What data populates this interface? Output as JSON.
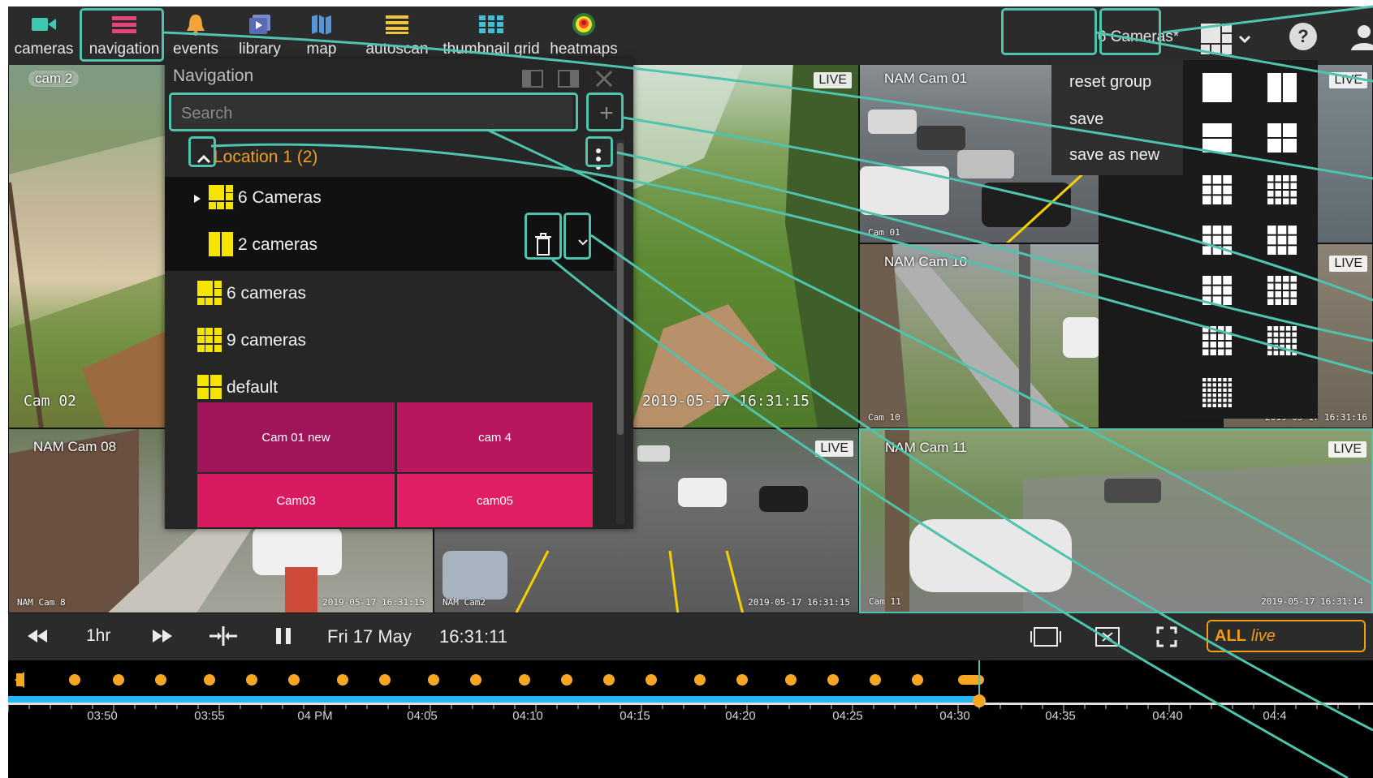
{
  "toolbar": {
    "items": [
      {
        "label": "cameras",
        "icon": "video-camera-icon"
      },
      {
        "label": "navigation",
        "icon": "navigation-list-icon"
      },
      {
        "label": "events",
        "icon": "bell-icon"
      },
      {
        "label": "library",
        "icon": "library-icon"
      },
      {
        "label": "map",
        "icon": "map-icon"
      },
      {
        "label": "autoscan",
        "icon": "autoscan-icon"
      },
      {
        "label": "thumbnail grid",
        "icon": "thumbnail-grid-icon"
      },
      {
        "label": "heatmaps",
        "icon": "heatmap-icon"
      }
    ],
    "group_name": "6 Cameras*",
    "help_label": "?"
  },
  "group_menu": {
    "items": [
      "reset group",
      "save",
      "save as new"
    ]
  },
  "navigation": {
    "title": "Navigation",
    "search_placeholder": "Search",
    "add_label": "+",
    "location": "Location 1 (2)",
    "groups": [
      {
        "label": "6 Cameras",
        "expandable": true
      },
      {
        "label": "2 cameras",
        "selected": true
      },
      {
        "label": "6 cameras"
      },
      {
        "label": "9 cameras"
      },
      {
        "label": "default"
      }
    ],
    "tiles": [
      "Cam 01 new",
      "cam 4",
      "Cam03",
      "cam05"
    ]
  },
  "cameras": [
    {
      "name": "cam 2",
      "overlay": "Cam 02"
    },
    {
      "name": "",
      "timestamp": "2019-05-17 16:31:15",
      "live": "LIVE"
    },
    {
      "name": "NAM Cam 01",
      "overlay": "Cam 01"
    },
    {
      "name": "NAM Cam 10",
      "overlay": "Cam 10",
      "timestamp": "2019-05-17 16:31:16",
      "live": "LIVE"
    },
    {
      "name": "NAM Cam 08",
      "overlay": "NAM Cam 8",
      "timestamp": "2019-05-17 16:31:15"
    },
    {
      "name": "",
      "overlay": "NAM Cam2",
      "timestamp": "2019-05-17 16:31:15",
      "live": "LIVE"
    },
    {
      "name": "NAM Cam 11",
      "overlay": "Cam 11",
      "timestamp": "2019-05-17 16:31:14",
      "live": "LIVE"
    }
  ],
  "controls": {
    "range": "1hr",
    "date": "Fri 17 May",
    "time": "16:31:11",
    "all_label": "ALL",
    "live_label": "live"
  },
  "timeline": {
    "ticks": [
      "03:50",
      "03:55",
      "04 PM",
      "04:05",
      "04:10",
      "04:15",
      "04:20",
      "04:25",
      "04:30",
      "04:35",
      "04:40",
      "04:4"
    ],
    "playhead": "04:31"
  },
  "colors": {
    "accent": "#4fc3ad",
    "location": "#f0a020",
    "tile_a": "#a0155a",
    "tile_b": "#d81b60",
    "progress": "#29b6f6",
    "marker": "#f5a623",
    "live_button": "#f39c12"
  }
}
